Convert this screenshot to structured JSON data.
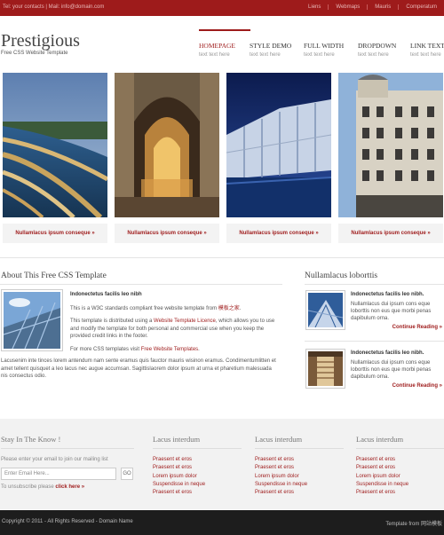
{
  "topbar": {
    "contact": "Tel: your contacts | Mail: info@domain.com",
    "links": [
      "Liens",
      "Webmaps",
      "Mauris",
      "Comperatum"
    ]
  },
  "header": {
    "logo": "Prestigious",
    "tagline": "Free CSS Website Template"
  },
  "nav": [
    {
      "label": "HOMEPAGE",
      "sub": "text text here"
    },
    {
      "label": "STYLE DEMO",
      "sub": "text text here"
    },
    {
      "label": "FULL WIDTH",
      "sub": "text text here"
    },
    {
      "label": "DROPDOWN",
      "sub": "text text here"
    },
    {
      "label": "LINK TEXT",
      "sub": "text text here"
    }
  ],
  "gallery": [
    {
      "caption": "Nullamlacus ipsum conseque »"
    },
    {
      "caption": "Nullamlacus ipsum conseque »"
    },
    {
      "caption": "Nullamlacus ipsum conseque »"
    },
    {
      "caption": "Nullamlacus ipsum conseque »"
    }
  ],
  "about": {
    "title": "About This Free CSS Template",
    "heading": "Indonectetus facilis leo nibh",
    "p1_pre": "This is a W3C standards compliant free website template from ",
    "p1_link": "模板之家",
    "p1_post": ".",
    "p2_pre": "This template is distributed using a ",
    "p2_link": "Website Template Licence",
    "p2_post": ", which allows you to use and modify the template for both personal and commercial use when you keep the provided credit links in the footer.",
    "p3_pre": "For more CSS templates visit ",
    "p3_link": "Free Website Templates",
    "p3_post": ".",
    "full": "Lacusenim inte tinces lorem antendum nam sente eramus quis fauctor mauris wisinon eramus. Condimentumlitten et amet tellent quisquet a leo lacus nec augue accumsan. Sagittislaorem dolor ipsum at urna et pharetium malesuada nis consectus odio."
  },
  "sidebar": {
    "title": "Nullamlacus loborttis",
    "items": [
      {
        "heading": "Indonectetus facilis leo nibh.",
        "text": "Nullamlacus dui ipsum cons eque loborttis non eus que morbi penas dapibulum orna.",
        "more": "Continue Reading »"
      },
      {
        "heading": "Indonectetus facilis leo nibh.",
        "text": "Nullamlacus dui ipsum cons eque loborttis non eus que morbi penas dapibulum orna.",
        "more": "Continue Reading »"
      }
    ]
  },
  "footer": {
    "newsletter": {
      "title": "Stay In The Know !",
      "text": "Please enter your email to join our mailing list",
      "placeholder": "Enter Email Here...",
      "go": "GO",
      "unsub_text": "To unsubscribe please ",
      "unsub_link": "click here »"
    },
    "columns": [
      {
        "title": "Lacus interdum",
        "links": [
          "Praesent et eros",
          "Praesent et eros",
          "Lorem ipsum dolor",
          "Suspendisse in neque",
          "Praesent et eros"
        ]
      },
      {
        "title": "Lacus interdum",
        "links": [
          "Praesent et eros",
          "Praesent et eros",
          "Lorem ipsum dolor",
          "Suspendisse in neque",
          "Praesent et eros"
        ]
      },
      {
        "title": "Lacus interdum",
        "links": [
          "Praesent et eros",
          "Praesent et eros",
          "Lorem ipsum dolor",
          "Suspendisse in neque",
          "Praesent et eros"
        ]
      }
    ]
  },
  "bottombar": {
    "copyright": "Copyright © 2011 - All Rights Reserved - Domain Name",
    "credit": "Template from 网站模板"
  },
  "colors": {
    "brand": "#9e1b1b",
    "footer_bg": "#1d1d1d",
    "band_bg": "#f2f2f2"
  }
}
